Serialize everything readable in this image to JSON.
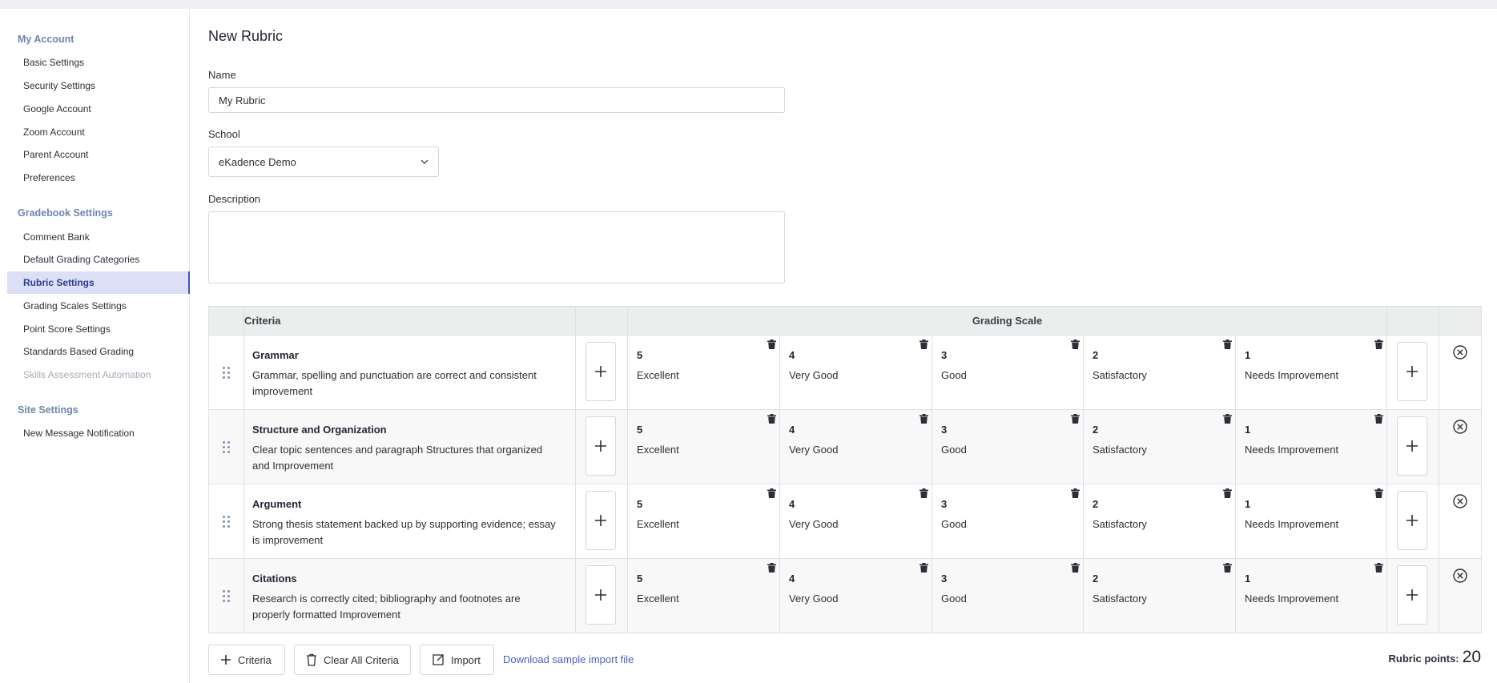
{
  "sidebar": {
    "sections": [
      {
        "title": "My Account",
        "items": [
          "Basic Settings",
          "Security Settings",
          "Google Account",
          "Zoom Account",
          "Parent Account",
          "Preferences"
        ]
      },
      {
        "title": "Gradebook Settings",
        "items": [
          "Comment Bank",
          "Default Grading Categories",
          "Rubric Settings",
          "Grading Scales Settings",
          "Point Score Settings",
          "Standards Based Grading",
          "Skills Assessment Automation"
        ]
      },
      {
        "title": "Site Settings",
        "items": [
          "New Message Notification"
        ]
      }
    ],
    "active_item": "Rubric Settings",
    "disabled_item": "Skills Assessment Automation"
  },
  "page": {
    "title": "New Rubric",
    "name_label": "Name",
    "name_value": "My Rubric",
    "school_label": "School",
    "school_value": "eKadence Demo",
    "description_label": "Description",
    "description_value": ""
  },
  "table": {
    "criteria_header": "Criteria",
    "grading_header": "Grading Scale",
    "rows": [
      {
        "title": "Grammar",
        "description": "Grammar, spelling and punctuation are correct and consistent improvement",
        "levels": [
          {
            "points": "5",
            "label": "Excellent"
          },
          {
            "points": "4",
            "label": "Very Good"
          },
          {
            "points": "3",
            "label": "Good"
          },
          {
            "points": "2",
            "label": "Satisfactory"
          },
          {
            "points": "1",
            "label": "Needs Improvement"
          }
        ]
      },
      {
        "title": "Structure and Organization",
        "description": "Clear topic sentences and paragraph Structures that organized and Improvement",
        "levels": [
          {
            "points": "5",
            "label": "Excellent"
          },
          {
            "points": "4",
            "label": "Very Good"
          },
          {
            "points": "3",
            "label": "Good"
          },
          {
            "points": "2",
            "label": "Satisfactory"
          },
          {
            "points": "1",
            "label": "Needs Improvement"
          }
        ]
      },
      {
        "title": "Argument",
        "description": "Strong thesis statement backed up by supporting evidence; essay is improvement",
        "levels": [
          {
            "points": "5",
            "label": "Excellent"
          },
          {
            "points": "4",
            "label": "Very Good"
          },
          {
            "points": "3",
            "label": "Good"
          },
          {
            "points": "2",
            "label": "Satisfactory"
          },
          {
            "points": "1",
            "label": "Needs Improvement"
          }
        ]
      },
      {
        "title": "Citations",
        "description": "Research is correctly cited; bibliography and footnotes are properly formatted Improvement",
        "levels": [
          {
            "points": "5",
            "label": "Excellent"
          },
          {
            "points": "4",
            "label": "Very Good"
          },
          {
            "points": "3",
            "label": "Good"
          },
          {
            "points": "2",
            "label": "Satisfactory"
          },
          {
            "points": "1",
            "label": "Needs Improvement"
          }
        ]
      }
    ]
  },
  "footer": {
    "add_criteria_label": "Criteria",
    "clear_all_label": "Clear All Criteria",
    "import_label": "Import",
    "download_link": "Download sample import file",
    "points_label": "Rubric points:",
    "points_value": "20"
  },
  "colors": {
    "accent": "#4356b9",
    "link": "#4b5ec4",
    "section_title": "#6e86ad",
    "active_bg": "#dcdff5"
  }
}
